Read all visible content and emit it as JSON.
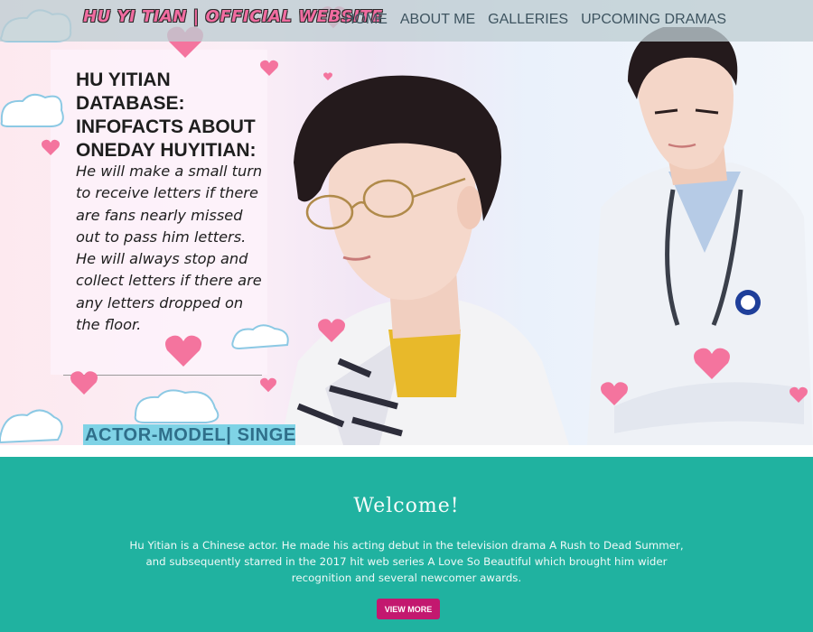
{
  "header": {
    "brand": "HU YI TIAN | OFFICIAL WEBSITE",
    "nav": [
      {
        "label": "HOME"
      },
      {
        "label": "ABOUT ME"
      },
      {
        "label": "GALLERIES"
      },
      {
        "label": "UPCOMING DRAMAS"
      }
    ]
  },
  "hero": {
    "heading": "HU YITIAN DATABASE: INFOFACTS ABOUT ONEDAY HUYITIAN:",
    "body": "He will make a small turn to receive letters if there are fans nearly missed out to pass him letters. He will always stop and collect letters if there are any letters dropped on the floor.",
    "tagline": "ACTOR-MODEL| SINGER"
  },
  "welcome": {
    "title": "Welcome!",
    "text": "Hu Yitian is a Chinese actor. He made his acting debut in the television drama A Rush to Dead Summer, and subsequently starred in the 2017 hit web series A Love So Beautiful which brought him wider recognition and several newcomer awards.",
    "button": "VIEW MORE"
  },
  "colors": {
    "teal": "#20b2a0",
    "button": "#c3186f",
    "heart": "#f4749e",
    "tagline_bg": "#7fd3e6"
  }
}
